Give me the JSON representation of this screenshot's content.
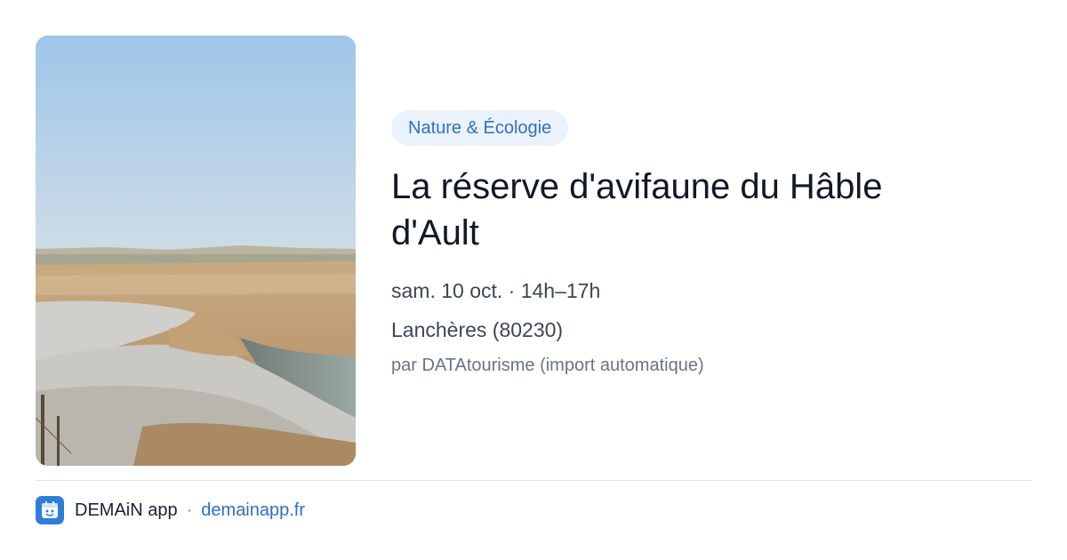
{
  "event": {
    "category": "Nature & Écologie",
    "title": "La réserve d'avifaune du Hâble d'Ault",
    "date_time": "sam. 10 oct. · 14h–17h",
    "location": "Lanchères (80230)",
    "source": "par DATAtourisme (import automatique)"
  },
  "footer": {
    "logo_icon": "calendar-face-icon",
    "app_name": "DEMAiN app",
    "separator": "·",
    "site": "demainapp.fr"
  },
  "colors": {
    "accent": "#2f6fc9",
    "tag_bg": "#eaf2fc",
    "logo_bg": "#2e7fd8"
  }
}
